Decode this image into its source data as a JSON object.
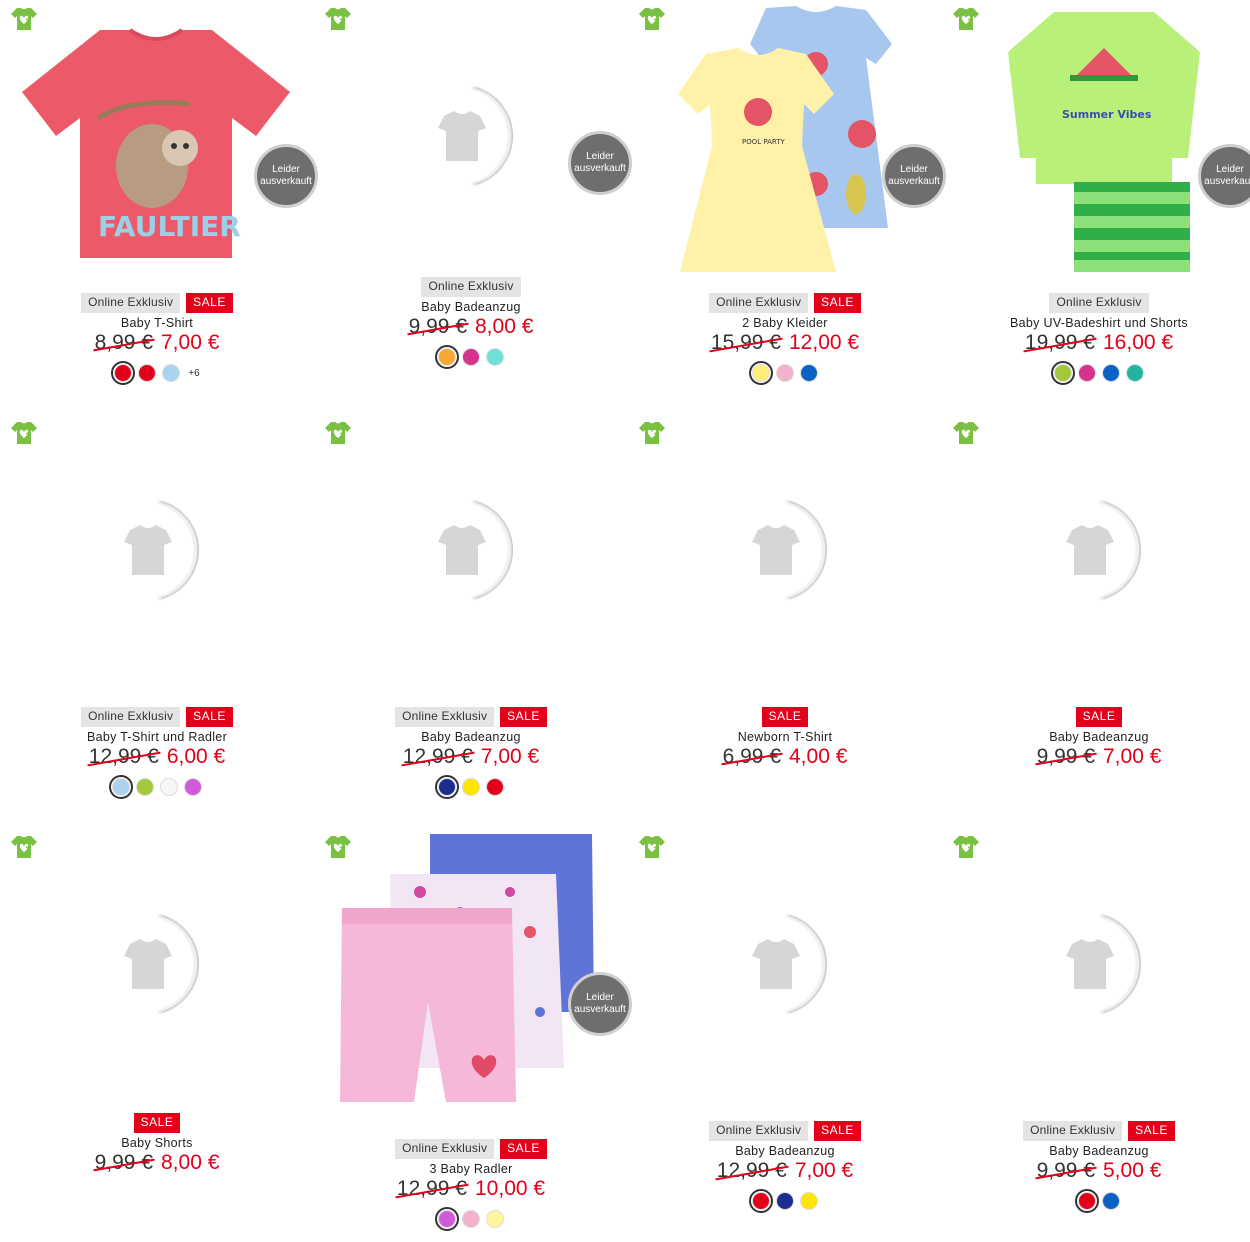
{
  "labels": {
    "online": "Online Exklusiv",
    "sale": "SALE",
    "soldout_line1": "Leider",
    "soldout_line2": "ausverkauft"
  },
  "colors": {
    "sale_red": "#e2001a",
    "eco_green": "#7ac143"
  },
  "products": [
    {
      "name": "Baby T-Shirt",
      "old_price": "8,99 €",
      "new_price": "7,00 €",
      "online": true,
      "sale": true,
      "soldout": true,
      "image": "sloth-tshirt-image",
      "swatches": [
        "#e2001a",
        "#e2001a",
        "#a9d3ef"
      ],
      "more": "+6"
    },
    {
      "name": "Baby Badeanzug",
      "old_price": "9,99 €",
      "new_price": "8,00 €",
      "online": true,
      "sale": false,
      "soldout": true,
      "image": "placeholder",
      "swatches": [
        "#f7a833",
        "#d6338c",
        "#6fe0d8"
      ],
      "more": ""
    },
    {
      "name": "2 Baby Kleider",
      "old_price": "15,99 €",
      "new_price": "12,00 €",
      "online": true,
      "sale": true,
      "soldout": true,
      "image": "dresses-image",
      "swatches": [
        "#fff07a",
        "#f2b2cd",
        "#0a62c5"
      ],
      "more": ""
    },
    {
      "name": "Baby UV-Badeshirt und Shorts",
      "old_price": "19,99 €",
      "new_price": "16,00 €",
      "online": true,
      "sale": false,
      "soldout": true,
      "image": "swimshirt-image",
      "swatches": [
        "#a3c93a",
        "#d6338c",
        "#0a62c5",
        "#22b4a0"
      ],
      "more": ""
    },
    {
      "name": "Baby T-Shirt und Radler",
      "old_price": "12,99 €",
      "new_price": "6,00 €",
      "online": true,
      "sale": true,
      "soldout": false,
      "image": "placeholder",
      "swatches": [
        "#a9d3ef",
        "#a3c93a",
        "#f7f7f7",
        "#d15ad9"
      ],
      "more": ""
    },
    {
      "name": "Baby Badeanzug",
      "old_price": "12,99 €",
      "new_price": "7,00 €",
      "online": true,
      "sale": true,
      "soldout": false,
      "image": "placeholder",
      "swatches": [
        "#1b2d8f",
        "#ffe500",
        "#e2001a"
      ],
      "more": ""
    },
    {
      "name": "Newborn T-Shirt",
      "old_price": "6,99 €",
      "new_price": "4,00 €",
      "online": false,
      "sale": true,
      "soldout": false,
      "image": "placeholder",
      "swatches": [],
      "more": ""
    },
    {
      "name": "Baby Badeanzug",
      "old_price": "9,99 €",
      "new_price": "7,00 €",
      "online": false,
      "sale": true,
      "soldout": false,
      "image": "placeholder",
      "swatches": [],
      "more": ""
    },
    {
      "name": "Baby Shorts",
      "old_price": "9,99 €",
      "new_price": "8,00 €",
      "online": false,
      "sale": true,
      "soldout": false,
      "image": "placeholder",
      "swatches": [],
      "more": ""
    },
    {
      "name": "3 Baby Radler",
      "old_price": "12,99 €",
      "new_price": "10,00 €",
      "online": true,
      "sale": true,
      "soldout": true,
      "image": "leggings-image",
      "swatches": [
        "#d15ad9",
        "#f2b2cd",
        "#fff59a"
      ],
      "more": ""
    },
    {
      "name": "Baby Badeanzug",
      "old_price": "12,99 €",
      "new_price": "7,00 €",
      "online": true,
      "sale": true,
      "soldout": false,
      "image": "placeholder",
      "swatches": [
        "#e2001a",
        "#1b2d8f",
        "#ffe500"
      ],
      "more": ""
    },
    {
      "name": "Baby Badeanzug",
      "old_price": "9,99 €",
      "new_price": "5,00 €",
      "online": true,
      "sale": true,
      "soldout": false,
      "image": "placeholder",
      "swatches": [
        "#e2001a",
        "#0a62c5"
      ],
      "more": ""
    }
  ]
}
